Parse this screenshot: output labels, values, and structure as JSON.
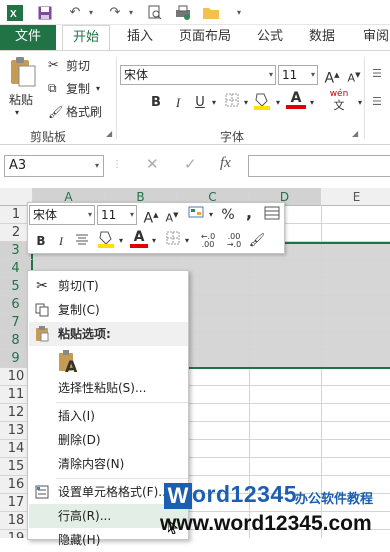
{
  "tabs": {
    "file": "文件",
    "home": "开始",
    "insert": "插入",
    "page_layout": "页面布局",
    "formulas": "公式",
    "data": "数据",
    "review": "审阅"
  },
  "clipboard": {
    "paste": "粘贴",
    "cut": "剪切",
    "copy": "复制",
    "format_painter": "格式刷",
    "group": "剪贴板"
  },
  "font": {
    "name": "宋体",
    "size": "11",
    "group": "字体",
    "bold": "B",
    "italic": "I",
    "underline": "U",
    "grow": "A",
    "shrink": "A",
    "phonetic": "wén",
    "phonetic_sub": "文"
  },
  "formula_bar": {
    "name_box": "A3",
    "fx": "fx"
  },
  "columns": [
    "A",
    "B",
    "C",
    "D",
    "E"
  ],
  "rows": [
    "1",
    "2",
    "3",
    "4",
    "5",
    "6",
    "7",
    "8",
    "9",
    "10",
    "11",
    "12",
    "13",
    "14",
    "15",
    "16",
    "17",
    "18",
    "19"
  ],
  "mini_toolbar": {
    "font": "宋体",
    "size": "11",
    "grow": "A",
    "shrink": "A",
    "percent": "%",
    "comma": ",",
    "bold": "B",
    "italic": "I",
    "fill": "A",
    "color": "A",
    "inc_decimal": "←.0\n.00",
    "dec_decimal": ".00\n→.0"
  },
  "context_menu": {
    "cut": "剪切(T)",
    "copy": "复制(C)",
    "paste_options": "粘贴选项:",
    "paste_icon_letter": "A",
    "paste_special": "选择性粘贴(S)...",
    "insert": "插入(I)",
    "delete": "删除(D)",
    "clear": "清除内容(N)",
    "format_cells": "设置单元格格式(F)...",
    "row_height": "行高(R)...",
    "hide": "隐藏(H)"
  },
  "watermark": {
    "brand_w": "W",
    "brand_rest": "ord12345",
    "slogan": "办公软件教程",
    "url": "www.word12345.com"
  },
  "colors": {
    "accent": "#217346",
    "font_red": "#e00000",
    "fill_yellow": "#ffe100"
  }
}
